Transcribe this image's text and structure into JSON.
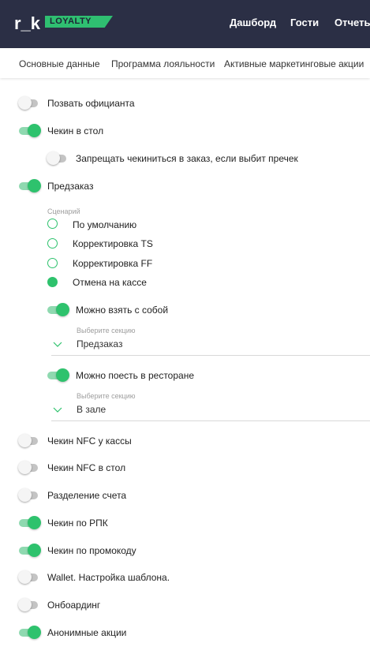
{
  "header": {
    "logo_text": "r_k",
    "logo_badge": "LOYALTY",
    "nav": [
      "Дашборд",
      "Гости",
      "Отчеты"
    ]
  },
  "tabs": [
    "Основные данные",
    "Программа лояльности",
    "Активные маркетинговые акции"
  ],
  "settings": {
    "call_waiter": {
      "label": "Позвать официанта",
      "on": false
    },
    "checkin_table": {
      "label": "Чекин в стол",
      "on": true
    },
    "forbid_checkin": {
      "label": "Запрещать чекиниться в заказ, если выбит пречек",
      "on": false
    },
    "preorder": {
      "label": "Предзаказ",
      "on": true
    },
    "scenario": {
      "caption": "Сценарий",
      "options": [
        "По умолчанию",
        "Корректировка TS",
        "Корректировка FF",
        "Отмена на кассе"
      ],
      "selected": "Отмена на кассе"
    },
    "takeaway": {
      "label": "Можно взять с собой",
      "on": true
    },
    "takeaway_section": {
      "caption": "Выберите секцию",
      "value": "Предзаказ"
    },
    "dine_in": {
      "label": "Можно поесть в ресторане",
      "on": true
    },
    "dine_in_section": {
      "caption": "Выберите секцию",
      "value": "В зале"
    },
    "nfc_cashier": {
      "label": "Чекин NFC у кассы",
      "on": false
    },
    "nfc_table": {
      "label": "Чекин NFC в стол",
      "on": false
    },
    "split_bill": {
      "label": "Разделение счета",
      "on": false
    },
    "checkin_rpk": {
      "label": "Чекин по РПК",
      "on": true
    },
    "checkin_promo": {
      "label": "Чекин по промокоду",
      "on": true
    },
    "wallet": {
      "label": "Wallet. Настройка шаблона.",
      "on": false
    },
    "onboarding": {
      "label": "Онбоардинг",
      "on": false
    },
    "anon_promos": {
      "label": "Анонимные акции",
      "on": true
    }
  },
  "colors": {
    "header_bg": "#2b2f45",
    "accent": "#2ec26d",
    "accent_light": "#8fd9b0",
    "toggle_off": "#c4c4c4"
  }
}
